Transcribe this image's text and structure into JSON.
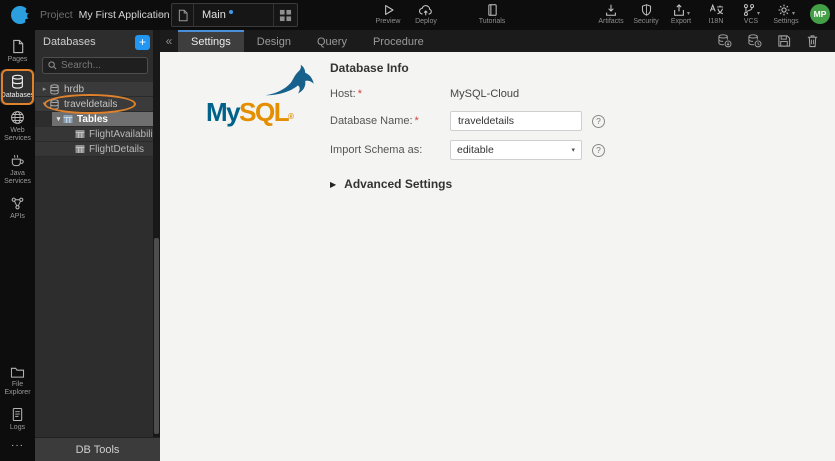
{
  "glyphs": {
    "chevron_right": "›",
    "collapse_left": "«",
    "caret_collapsed": "▸",
    "caret_expanded": "▾",
    "caret_solid_right": "▶",
    "select_caret": "▾",
    "plus": "+"
  },
  "topbar": {
    "project_label": "Project",
    "project_name": "My First Application",
    "page_tab_label": "Main",
    "preview_label": "Preview",
    "deploy_label": "Deploy",
    "tutorials_label": "Tutorials",
    "artifacts_label": "Artifacts",
    "security_label": "Security",
    "export_label": "Export",
    "i18n_label": "I18N",
    "vcs_label": "VCS",
    "settings_label": "Settings",
    "avatar_initials": "MP"
  },
  "sidebar": {
    "items": [
      {
        "label": "Pages",
        "active": false
      },
      {
        "label": "Databases",
        "active": true
      },
      {
        "label": "Web Services",
        "active": false
      },
      {
        "label": "Java Services",
        "active": false
      },
      {
        "label": "APIs",
        "active": false
      }
    ],
    "bottom_items": [
      {
        "label": "File Explorer"
      },
      {
        "label": "Logs"
      },
      {
        "label": "···"
      }
    ]
  },
  "db_panel": {
    "title": "Databases",
    "add_button": "+",
    "search_placeholder": "Search...",
    "tree": {
      "hrdb": "hrdb",
      "traveldetails": "traveldetails",
      "tables": "Tables",
      "flight_availability": "FlightAvailability",
      "flight_details": "FlightDetails"
    },
    "footer_button": "DB Tools"
  },
  "main": {
    "tabs": [
      {
        "label": "Settings",
        "active": true
      },
      {
        "label": "Design",
        "active": false
      },
      {
        "label": "Query",
        "active": false
      },
      {
        "label": "Procedure",
        "active": false
      }
    ],
    "toolbar_icons": [
      "reimport-database",
      "export-database",
      "save",
      "delete"
    ],
    "logo": {
      "part1": "My",
      "part2": "SQL",
      "reg": "®"
    },
    "form": {
      "section_title": "Database Info",
      "required_mark": "*",
      "host_label": "Host:",
      "host_value": "MySQL-Cloud",
      "dbname_label": "Database Name:",
      "dbname_value": "traveldetails",
      "import_label": "Import Schema as:",
      "import_value": "editable",
      "advanced_label": "Advanced Settings",
      "help_mark": "?"
    }
  },
  "colors": {
    "accent_blue": "#2196f3",
    "tab_active_border": "#4a90d9",
    "annotation_orange": "#e0822c",
    "avatar_green": "#43a047",
    "mysql_blue": "#00618a",
    "mysql_orange": "#e48e00"
  }
}
